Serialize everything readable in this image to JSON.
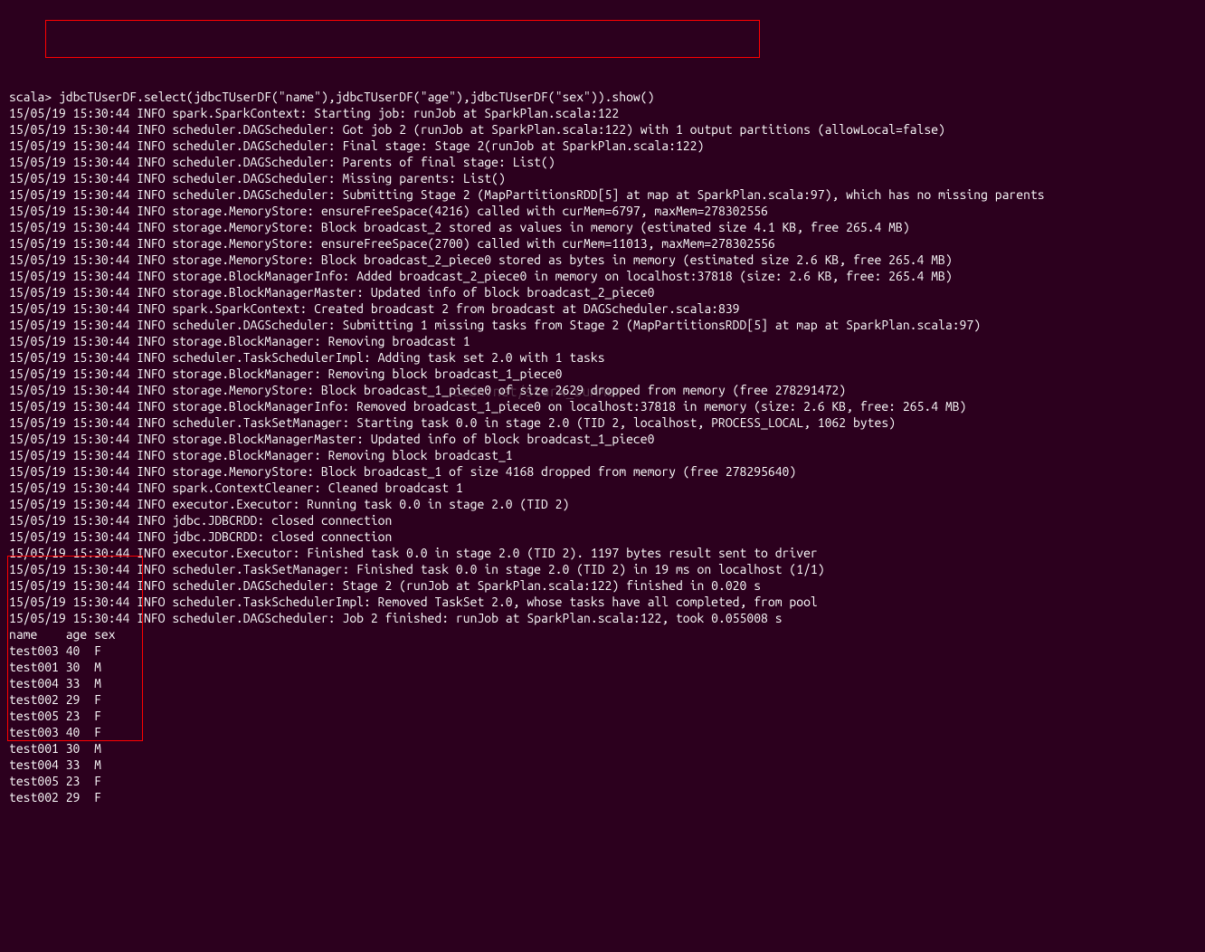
{
  "prompt_prefix": "scala> ",
  "command": "jdbcTUserDF.select(jdbcTUserDF(\"name\"),jdbcTUserDF(\"age\"),jdbcTUserDF(\"sex\")).show()",
  "watermark_text": "csdn.net/stark_summer",
  "log_lines": [
    "15/05/19 15:30:44 INFO spark.SparkContext: Starting job: runJob at SparkPlan.scala:122",
    "15/05/19 15:30:44 INFO scheduler.DAGScheduler: Got job 2 (runJob at SparkPlan.scala:122) with 1 output partitions (allowLocal=false)",
    "15/05/19 15:30:44 INFO scheduler.DAGScheduler: Final stage: Stage 2(runJob at SparkPlan.scala:122)",
    "15/05/19 15:30:44 INFO scheduler.DAGScheduler: Parents of final stage: List()",
    "15/05/19 15:30:44 INFO scheduler.DAGScheduler: Missing parents: List()",
    "15/05/19 15:30:44 INFO scheduler.DAGScheduler: Submitting Stage 2 (MapPartitionsRDD[5] at map at SparkPlan.scala:97), which has no missing parents",
    "15/05/19 15:30:44 INFO storage.MemoryStore: ensureFreeSpace(4216) called with curMem=6797, maxMem=278302556",
    "15/05/19 15:30:44 INFO storage.MemoryStore: Block broadcast_2 stored as values in memory (estimated size 4.1 KB, free 265.4 MB)",
    "15/05/19 15:30:44 INFO storage.MemoryStore: ensureFreeSpace(2700) called with curMem=11013, maxMem=278302556",
    "15/05/19 15:30:44 INFO storage.MemoryStore: Block broadcast_2_piece0 stored as bytes in memory (estimated size 2.6 KB, free 265.4 MB)",
    "15/05/19 15:30:44 INFO storage.BlockManagerInfo: Added broadcast_2_piece0 in memory on localhost:37818 (size: 2.6 KB, free: 265.4 MB)",
    "15/05/19 15:30:44 INFO storage.BlockManagerMaster: Updated info of block broadcast_2_piece0",
    "15/05/19 15:30:44 INFO spark.SparkContext: Created broadcast 2 from broadcast at DAGScheduler.scala:839",
    "15/05/19 15:30:44 INFO scheduler.DAGScheduler: Submitting 1 missing tasks from Stage 2 (MapPartitionsRDD[5] at map at SparkPlan.scala:97)",
    "15/05/19 15:30:44 INFO storage.BlockManager: Removing broadcast 1",
    "15/05/19 15:30:44 INFO scheduler.TaskSchedulerImpl: Adding task set 2.0 with 1 tasks",
    "15/05/19 15:30:44 INFO storage.BlockManager: Removing block broadcast_1_piece0",
    "15/05/19 15:30:44 INFO storage.MemoryStore: Block broadcast_1_piece0 of size 2629 dropped from memory (free 278291472)",
    "15/05/19 15:30:44 INFO storage.BlockManagerInfo: Removed broadcast_1_piece0 on localhost:37818 in memory (size: 2.6 KB, free: 265.4 MB)",
    "15/05/19 15:30:44 INFO scheduler.TaskSetManager: Starting task 0.0 in stage 2.0 (TID 2, localhost, PROCESS_LOCAL, 1062 bytes)",
    "15/05/19 15:30:44 INFO storage.BlockManagerMaster: Updated info of block broadcast_1_piece0",
    "15/05/19 15:30:44 INFO storage.BlockManager: Removing block broadcast_1",
    "15/05/19 15:30:44 INFO storage.MemoryStore: Block broadcast_1 of size 4168 dropped from memory (free 278295640)",
    "15/05/19 15:30:44 INFO spark.ContextCleaner: Cleaned broadcast 1",
    "15/05/19 15:30:44 INFO executor.Executor: Running task 0.0 in stage 2.0 (TID 2)",
    "15/05/19 15:30:44 INFO jdbc.JDBCRDD: closed connection",
    "15/05/19 15:30:44 INFO jdbc.JDBCRDD: closed connection",
    "15/05/19 15:30:44 INFO executor.Executor: Finished task 0.0 in stage 2.0 (TID 2). 1197 bytes result sent to driver",
    "15/05/19 15:30:44 INFO scheduler.TaskSetManager: Finished task 0.0 in stage 2.0 (TID 2) in 19 ms on localhost (1/1)",
    "15/05/19 15:30:44 INFO scheduler.DAGScheduler: Stage 2 (runJob at SparkPlan.scala:122) finished in 0.020 s",
    "15/05/19 15:30:44 INFO scheduler.TaskSchedulerImpl: Removed TaskSet 2.0, whose tasks have all completed, from pool",
    "15/05/19 15:30:44 INFO scheduler.DAGScheduler: Job 2 finished: runJob at SparkPlan.scala:122, took 0.055008 s"
  ],
  "table_header": "name    age sex",
  "table_rows": [
    "test003 40  F  ",
    "test001 30  M  ",
    "test004 33  M  ",
    "test002 29  F  ",
    "test005 23  F  ",
    "test003 40  F  ",
    "test001 30  M  ",
    "test004 33  M  ",
    "test005 23  F  ",
    "test002 29  F  "
  ],
  "final_prompt": ""
}
